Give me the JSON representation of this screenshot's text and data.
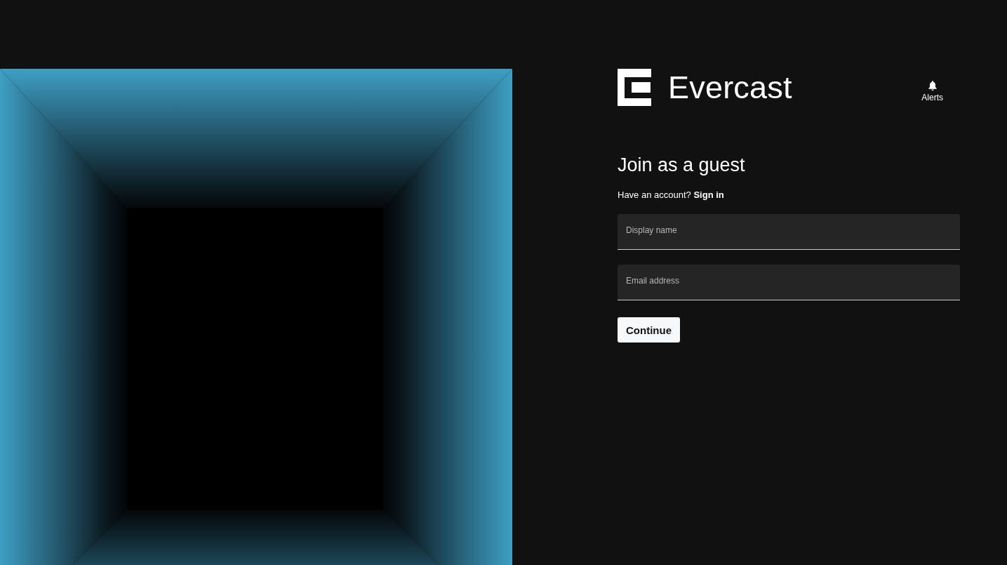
{
  "header": {
    "logo": {
      "wordmark": "Evercast"
    },
    "alerts": {
      "label": "Alerts"
    }
  },
  "form": {
    "title": "Join as a guest",
    "prompt": "Have an account?",
    "sign_in_link": "Sign in",
    "fields": [
      {
        "placeholder": "Display name"
      },
      {
        "placeholder": "Email address"
      }
    ],
    "submit": "Continue"
  }
}
